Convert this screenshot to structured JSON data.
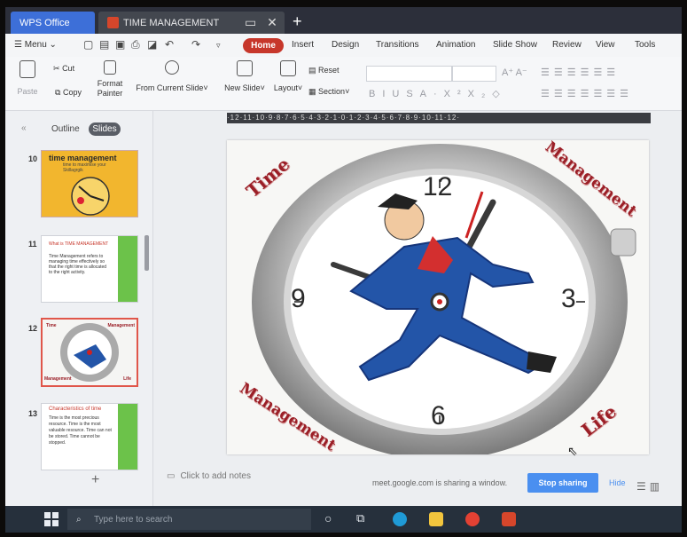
{
  "titlebar": {
    "app_tab": "WPS Office",
    "doc_tab": "TIME MANAGEMENT"
  },
  "menubar": {
    "menu_label": "Menu",
    "tabs": [
      "Home",
      "Insert",
      "Design",
      "Transitions",
      "Animation",
      "Slide Show",
      "Review",
      "View",
      "Tools"
    ],
    "active_tab": "Home"
  },
  "ribbon": {
    "cut": "Cut",
    "copy": "Copy",
    "paste": "Paste",
    "format_painter": "Format\nPainter",
    "from_current_slide": "From Current Slide",
    "new_slide": "New Slide",
    "layout": "Layout",
    "reset": "Reset",
    "section": "Section"
  },
  "left_panel": {
    "outline_tab": "Outline",
    "slides_tab": "Slides",
    "slides": [
      {
        "number": "10",
        "title": "time management",
        "subtitle": "time to maximise your Skillagrgik"
      },
      {
        "number": "11",
        "title": "What is TIME MANAGEMENT",
        "body": "Time Management refers to managing time effectively so that the right time is allocated to the right activity."
      },
      {
        "number": "12",
        "words": [
          "Time",
          "Management",
          "Management",
          "Life"
        ]
      },
      {
        "number": "13",
        "title": "Characteristics of time",
        "body": "Time is the most precious resource. Time is the most valuable resource. Time can not be stored. Time cannot be stopped."
      }
    ]
  },
  "ruler_text": "·12·11·10·9·8·7·6·5·4·3·2·1·0·1·2·3·4·5·6·7·8·9·10·11·12·",
  "slide": {
    "top_left": "Time",
    "top_right": "Management",
    "bottom_left": "Management",
    "bottom_right": "Life",
    "clock_numbers": [
      "12",
      "3",
      "6",
      "9"
    ]
  },
  "notes_placeholder": "Click to add notes",
  "sharing": {
    "message": "meet.google.com is sharing a window.",
    "stop_button": "Stop sharing",
    "hide_button": "Hide"
  },
  "taskbar": {
    "search_placeholder": "Type here to search"
  },
  "colors": {
    "accent_red": "#c7372b",
    "wps_blue": "#3d6fd8",
    "share_blue": "#4a8ff0",
    "slide_text": "#9b1f27"
  }
}
